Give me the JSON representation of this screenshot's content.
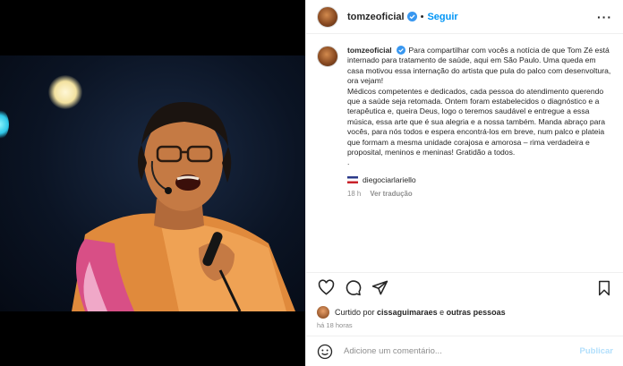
{
  "account": {
    "username": "tomzeoficial",
    "follow_label": "Seguir",
    "separator": "•",
    "more": "···"
  },
  "caption": {
    "username": "tomzeoficial",
    "text": "Para compartilhar com vocês a notícia de que Tom Zé está internado para tratamento de saúde, aqui em São Paulo. Uma queda em casa motivou essa internação do artista que pula do palco com desenvoltura, ora vejam!\nMédicos competentes e dedicados, cada pessoa do atendimento querendo que a saúde seja retomada. Ontem foram estabelecidos o diagnóstico e a terapêutica e, queira Deus, logo o teremos saudável e entregue a essa música, essa arte que é sua alegria e a nossa também. Manda abraço para vocês, para nós todos e espera encontrá-los em breve, num palco e plateia que formam a mesma unidade corajosa e amorosa – rima verdadeira e proposital, meninos e meninas! Gratidão a todos.\n.",
    "tagged_user": "diegociarlariello",
    "age": "18 h",
    "translate_label": "Ver tradução"
  },
  "likes": {
    "prefix": "Curtido por",
    "user": "cissaguimaraes",
    "conj": "e",
    "others": "outras pessoas"
  },
  "timestamp": "há 18 horas",
  "comment": {
    "placeholder": "Adicione um comentário...",
    "publish_label": "Publicar"
  },
  "icons": [
    "heart-icon",
    "comment-icon",
    "share-icon",
    "bookmark-icon",
    "emoji-icon",
    "verified-icon",
    "flag-icon"
  ],
  "colors": {
    "accent": "#0095f6",
    "verified": "#3897f0",
    "muted": "#8e8e8e",
    "publish_disabled": "#b2dffc"
  }
}
